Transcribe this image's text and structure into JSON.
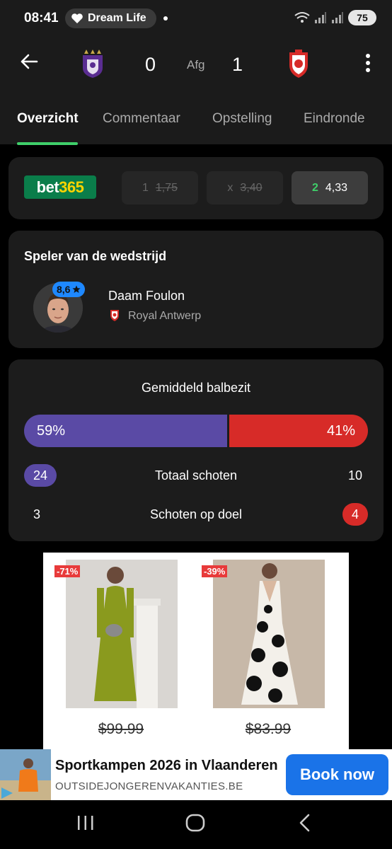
{
  "statusbar": {
    "time": "08:41",
    "pill_label": "Dream Life",
    "battery": "75",
    "icons": [
      "wifi-icon",
      "signal-icon",
      "signal-icon"
    ]
  },
  "header": {
    "home_team_crest": "anderlecht-crest",
    "away_team_crest": "royal-antwerp-crest",
    "score_home": "0",
    "score_away": "1",
    "status": "Afg"
  },
  "tabs": [
    {
      "label": "Overzicht",
      "active": true
    },
    {
      "label": "Commentaar",
      "active": false
    },
    {
      "label": "Opstelling",
      "active": false
    },
    {
      "label": "Eindronde",
      "active": false
    }
  ],
  "odds": {
    "brand_part1": "bet",
    "brand_part2": "365",
    "items": [
      {
        "label": "1",
        "value": "1,75"
      },
      {
        "label": "x",
        "value": "3,40"
      },
      {
        "label": "2",
        "value": "4,33"
      }
    ]
  },
  "motm": {
    "title": "Speler van de wedstrijd",
    "rating": "8,6",
    "player_name": "Daam Foulon",
    "team": "Royal Antwerp"
  },
  "stats": {
    "possession_title": "Gemiddeld balbezit",
    "possession_home": "59%",
    "possession_away": "41%",
    "possession_home_fraction": 0.59,
    "rows": [
      {
        "label": "Totaal schoten",
        "home": "24",
        "away": "10",
        "highlight": "home"
      },
      {
        "label": "Schoten op doel",
        "home": "3",
        "away": "4",
        "highlight": "away"
      }
    ]
  },
  "ad_products": [
    {
      "discount": "-71%",
      "price": "$99.99"
    },
    {
      "discount": "-39%",
      "price": "$83.99"
    }
  ],
  "banner": {
    "title": "Sportkampen 2026 in Vlaanderen",
    "url": "OUTSIDEJONGERENVAKANTIES.BE",
    "cta": "Book now"
  },
  "colors": {
    "home": "#5a4aa5",
    "away": "#d72b28",
    "accent": "#3fcf6a",
    "cta": "#1a73e8"
  }
}
